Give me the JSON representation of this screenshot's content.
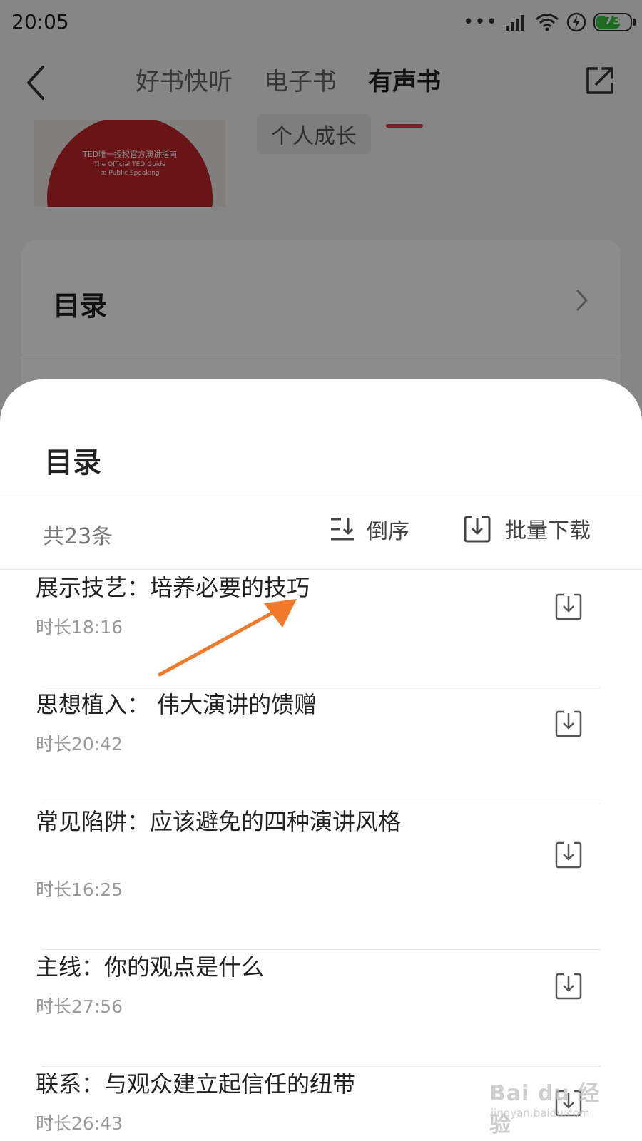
{
  "status_bar": {
    "time": "20:05",
    "signal_dots": "•••",
    "battery_level": "73",
    "battery_fraction": 0.73,
    "battery_color": "#38c23c"
  },
  "nav": {
    "tabs": [
      {
        "label": "好书快听",
        "active": false
      },
      {
        "label": "电子书",
        "active": false
      },
      {
        "label": "有声书",
        "active": true
      }
    ],
    "accent_color": "#d43c3c"
  },
  "book": {
    "cover_line1": "TED唯一授权官方演讲指南",
    "cover_line2": "The Official TED Guide",
    "cover_line3": "to Public Speaking",
    "tag": "个人成长"
  },
  "toc_card": {
    "title": "目录"
  },
  "sheet": {
    "title": "目录",
    "count_label": "共23条",
    "sort_label": "倒序",
    "download_all_label": "批量下载"
  },
  "chapters": [
    {
      "title": "展示技艺：培养必要的技巧",
      "duration": "时长18:16"
    },
    {
      "title": "思想植入： 伟大演讲的馈赠",
      "duration": "时长20:42"
    },
    {
      "title": "常见陷阱：应该避免的四种演讲风格",
      "duration": "时长16:25"
    },
    {
      "title": "主线：你的观点是什么",
      "duration": "时长27:56"
    },
    {
      "title": "联系：与观众建立起信任的纽带",
      "duration": "时长26:43"
    }
  ],
  "watermark": {
    "main": "Bai du 经验",
    "sub": "jingyan.baidu.com"
  }
}
